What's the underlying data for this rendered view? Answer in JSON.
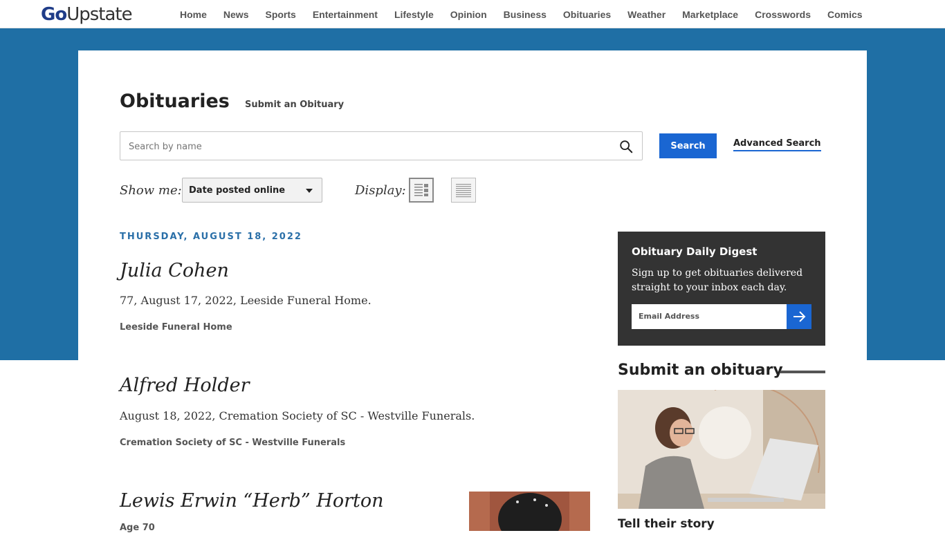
{
  "header": {
    "logo_go": "Go",
    "logo_rest": "Upstate",
    "nav": [
      "Home",
      "News",
      "Sports",
      "Entertainment",
      "Lifestyle",
      "Opinion",
      "Business",
      "Obituaries",
      "Weather",
      "Marketplace",
      "Crosswords",
      "Comics"
    ]
  },
  "page": {
    "title": "Obituaries",
    "submit_link": "Submit an Obituary"
  },
  "search": {
    "placeholder": "Search by name",
    "button_label": "Search",
    "advanced_label": "Advanced Search"
  },
  "filters": {
    "show_me_label": "Show me:",
    "show_me_value": "Date posted online",
    "display_label": "Display:"
  },
  "listing": {
    "date_heading": "THURSDAY, AUGUST 18, 2022",
    "obituaries": [
      {
        "name": "Julia Cohen",
        "summary": "77, August 17, 2022, Leeside Funeral Home.",
        "home": "Leeside Funeral Home"
      },
      {
        "name": "Alfred Holder",
        "summary": "August 18, 2022, Cremation Society of SC - Westville Funerals.",
        "home": "Cremation Society of SC - Westville Funerals"
      },
      {
        "name": "Lewis Erwin “Herb” Horton",
        "summary": "Age 70",
        "home": ""
      }
    ]
  },
  "sidebar": {
    "digest_title": "Obituary Daily Digest",
    "digest_text": "Sign up to get obituaries delivered straight to your inbox each day.",
    "email_placeholder": "Email Address",
    "submit_heading": "Submit an obituary",
    "tell_story": "Tell their story"
  },
  "colors": {
    "band_blue": "#1f6fa5",
    "button_blue": "#1a66d2",
    "date_blue": "#2a6fa8",
    "digest_bg": "#333333"
  }
}
